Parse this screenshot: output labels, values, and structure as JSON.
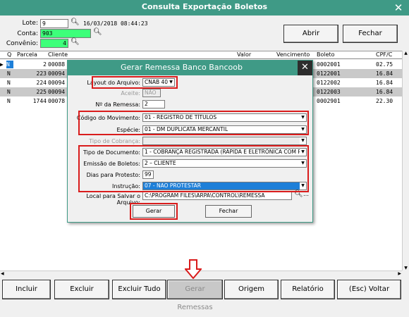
{
  "window": {
    "title": "Consulta Exportação Boletos",
    "close": "✕"
  },
  "filters": {
    "lote_label": "Lote:",
    "lote_value": "9",
    "datetime": "16/03/2018 08:44:23",
    "conta_label": "Conta:",
    "conta_value": "903",
    "convenio_label": "Convênio:",
    "convenio_value": "4"
  },
  "buttons": {
    "abrir": "Abrir",
    "fechar": "Fechar"
  },
  "grid": {
    "headers": [
      "Q",
      "Parcela",
      "Cliente",
      "Valor",
      "Vencimento",
      "Boleto",
      "CPF/C"
    ],
    "rows": [
      {
        "q": "N",
        "parcela": "2",
        "cliente": "00088",
        "boleto": "0002001",
        "cpf": "02.75"
      },
      {
        "q": "N",
        "parcela": "223",
        "cliente": "00094",
        "boleto": "0122001",
        "cpf": "16.84"
      },
      {
        "q": "N",
        "parcela": "224",
        "cliente": "00094",
        "boleto": "0122002",
        "cpf": "16.84"
      },
      {
        "q": "N",
        "parcela": "225",
        "cliente": "00094",
        "boleto": "0122003",
        "cpf": "16.84"
      },
      {
        "q": "N",
        "parcela": "1744",
        "cliente": "00078",
        "boleto": "0002901",
        "cpf": "22.30"
      }
    ]
  },
  "dialog": {
    "title": "Gerar Remessa Banco Bancoob",
    "close": "✕",
    "layout_label": "Layout do Arquivo:",
    "layout_value": "CNAB 400",
    "aceite_label": "Aceite:",
    "aceite_value": "NÃO",
    "remessa_label": "Nº da Remessa:",
    "remessa_value": "2",
    "movimento_label": "Código do Movimento:",
    "movimento_value": "01 - REGISTRO DE TÍTULOS",
    "especie_label": "Espécie:",
    "especie_value": "01 - DM DUPLICATA MERCANTIL",
    "cobranca_label": "Tipo de Cobrança:",
    "cobranca_value": "",
    "documento_label": "Tipo de Documento:",
    "documento_value": "1 - COBRANÇA REGISTRADA (RÁPIDA E ELETRÔNICA COM REGIS",
    "emissao_label": "Emissão de Boletos:",
    "emissao_value": "2 – CLIENTE",
    "protesto_label": "Dias para Protesto:",
    "protesto_value": "99",
    "instrucao_label": "Instrução:",
    "instrucao_value": "07 - NAO PROTESTAR",
    "local_label": "Local para Salvar o Arquivo:",
    "local_value": "C:\\PROGRAM FILES\\ARPA\\CONTROL\\REMESSA",
    "gerar": "Gerar",
    "fechar": "Fechar"
  },
  "toolbar": {
    "incluir": "Incluir",
    "excluir": "Excluir",
    "excluir_tudo": "Excluir Tudo",
    "gerar_remessas": "Gerar Remessas",
    "origem": "Origem",
    "relatorio": "Relatório",
    "voltar": "(Esc) Voltar"
  },
  "colors": {
    "titlebar": "#3f9a86",
    "highlight_field": "#3dff7a",
    "annotation": "#d91c1c",
    "selection": "#1e7fd8"
  },
  "icons": [
    "search-icon",
    "close-icon",
    "dropdown-arrow-icon",
    "down-arrow-annotation-icon"
  ]
}
